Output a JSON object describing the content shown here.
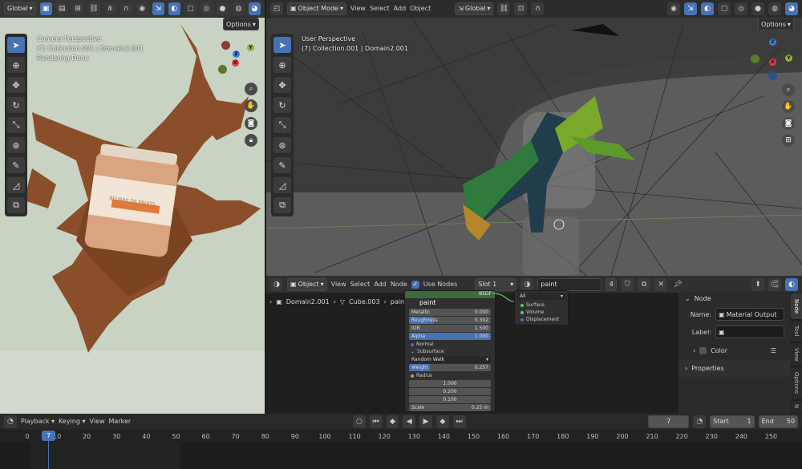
{
  "left_viewport": {
    "header": {
      "orientation": "Global",
      "options": "Options"
    },
    "overlay": {
      "line1": "Camera Perspective",
      "line2": "(7) Collection.001 | Domain2.001",
      "line3": "Rendering Done"
    },
    "label_text": "BEURRE DE FRUITS"
  },
  "right_viewport": {
    "header": {
      "mode": "Object Mode",
      "menu": [
        "View",
        "Select",
        "Add",
        "Object"
      ],
      "orientation": "Global",
      "options": "Options"
    },
    "overlay": {
      "line1": "User Perspective",
      "line2": "(7) Collection.001 | Domain2.001"
    }
  },
  "axes": {
    "x": "X",
    "y": "Y",
    "z": "Z"
  },
  "shader_editor": {
    "header": {
      "editor_type": "Object",
      "menu": [
        "View",
        "Select",
        "Add",
        "Node"
      ],
      "use_nodes": "Use Nodes",
      "slot": "Slot 1",
      "material": "paint",
      "users": "4"
    },
    "breadcrumb": {
      "object": "Domain2.001",
      "mesh": "Cube.003",
      "material": "paint"
    },
    "bsdf_node": {
      "title": "BSDF",
      "rows": [
        {
          "label": "Metallic",
          "value": "0.000",
          "fill": 0
        },
        {
          "label": "Roughness",
          "value": "0.302",
          "fill": 0.302
        },
        {
          "label": "IOR",
          "value": "1.500",
          "fill": 0
        },
        {
          "label": "Alpha",
          "value": "1.000",
          "fill": 1
        }
      ],
      "normal": "Normal",
      "subsurface": "Subsurface",
      "method": "Random Walk",
      "weight_label": "Weight",
      "weight_value": "0.257",
      "weight_fill": 0.257,
      "radius_label": "Radius",
      "radius": [
        "1.000",
        "0.200",
        "0.100"
      ],
      "scale_label": "Scale",
      "scale_value": "0.25 m"
    },
    "output_node": {
      "target": "All",
      "sockets": [
        "Surface",
        "Volume",
        "Displacement"
      ]
    }
  },
  "sidebar": {
    "panel": "Node",
    "name_label": "Name:",
    "name_value": "Material Output",
    "label_label": "Label:",
    "color": "Color",
    "properties": "Properties",
    "tabs": [
      "Node",
      "Tool",
      "View",
      "Options",
      "N"
    ]
  },
  "timeline": {
    "menu": [
      "Playback",
      "Keying",
      "View",
      "Marker"
    ],
    "current_frame": "7",
    "start_label": "Start",
    "start": "1",
    "end_label": "End",
    "end": "50",
    "ticks": [
      "0",
      "10",
      "20",
      "30",
      "40",
      "50",
      "60",
      "70",
      "80",
      "90",
      "100",
      "110",
      "120",
      "130",
      "140",
      "150",
      "160",
      "170",
      "180",
      "190",
      "200",
      "210",
      "220",
      "230",
      "240",
      "250"
    ]
  },
  "colors": {
    "accent": "#4772b3",
    "header": "#303030",
    "bg": "#1d1d1d",
    "x_axis": "#e3394a",
    "y_axis": "#8db82a",
    "z_axis": "#3a7ee3"
  }
}
